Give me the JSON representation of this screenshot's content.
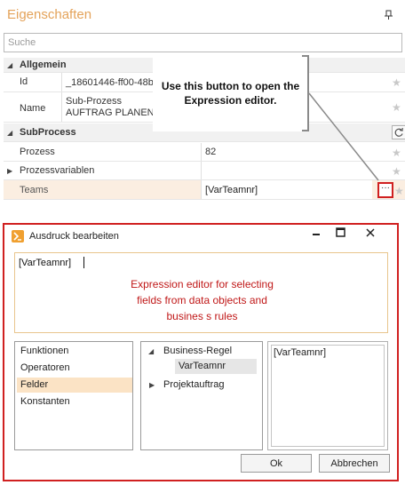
{
  "panel": {
    "title": "Eigenschaften",
    "search_placeholder": "Suche"
  },
  "grid": {
    "cat_general": "Allgemein",
    "id_label": "Id",
    "id_value": "_18601446-ff00-48b",
    "name_label": "Name",
    "name_value_line1": "Sub-Prozess",
    "name_value_line2": "AUFTRAG PLANEN",
    "cat_subprocess": "SubProcess",
    "prozess_label": "Prozess",
    "prozess_value": "82",
    "vars_label": "Prozessvariablen",
    "teams_label": "Teams",
    "teams_value": "[VarTeamnr]",
    "ellipsis": "···"
  },
  "callout": {
    "line1": "Use this button to open the",
    "line2": "Expression editor."
  },
  "dialog": {
    "title": "Ausdruck bearbeiten",
    "minimize": "▬",
    "maximize": "☐",
    "close": "✕",
    "expression": "[VarTeamnr]",
    "note_line1": "Expression editor for selecting",
    "note_line2": "fields from data objects and",
    "note_line3": "busines s rules",
    "categories": [
      "Funktionen",
      "Operatoren",
      "Felder",
      "Konstanten"
    ],
    "tree_business": "Business-Regel",
    "tree_var": "VarTeamnr",
    "tree_project": "Projektauftrag",
    "preview": "[VarTeamnr]",
    "ok": "Ok",
    "cancel": "Abbrechen"
  },
  "colors": {
    "accent_title": "#e4a35a",
    "highlight_border": "#d02020",
    "selection": "#fbe3c5",
    "note_text": "#c01818"
  }
}
